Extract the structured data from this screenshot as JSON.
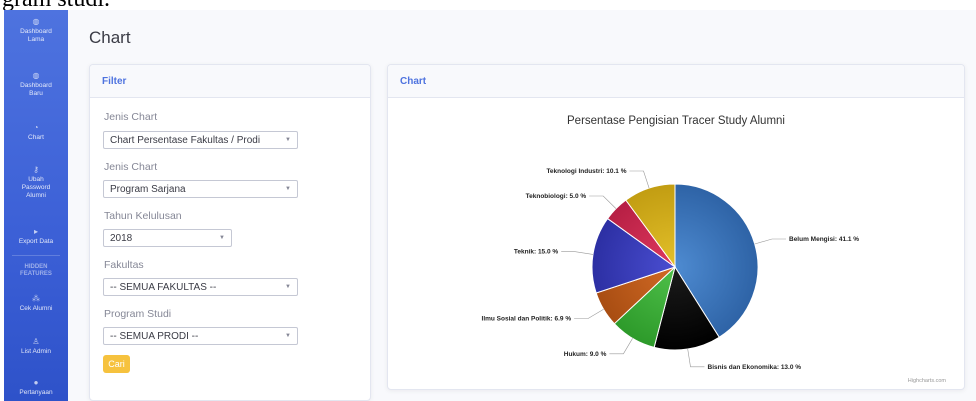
{
  "overflow_text": "gram studi.",
  "sidebar": {
    "items": [
      {
        "icon": "dashboard-icon",
        "label_lines": [
          "Dashboard",
          "Lama"
        ]
      },
      {
        "icon": "dashboard-icon",
        "label_lines": [
          "Dashboard",
          "Baru"
        ]
      },
      {
        "icon": "chart-icon",
        "label_lines": [
          "Chart"
        ]
      },
      {
        "icon": "key-icon",
        "label_lines": [
          "Ubah",
          "Password",
          "Alumni"
        ]
      },
      {
        "icon": "export-icon",
        "label_lines": [
          "Export Data"
        ]
      }
    ],
    "hidden_heading_lines": [
      "HIDDEN",
      "FEATURES"
    ],
    "hidden_items": [
      {
        "icon": "users-icon",
        "label_lines": [
          "Cek Alumni"
        ]
      },
      {
        "icon": "user-icon",
        "label_lines": [
          "List Admin"
        ]
      },
      {
        "icon": "question-icon",
        "label_lines": [
          "Pertanyaan"
        ]
      }
    ]
  },
  "page_title": "Chart",
  "filter": {
    "header": "Filter",
    "fields": [
      {
        "label": "Jenis Chart",
        "value": "Chart Persentase Fakultas / Prodi"
      },
      {
        "label": "Jenis Chart",
        "value": "Program Sarjana"
      },
      {
        "label": "Tahun Kelulusan",
        "value": "2018"
      },
      {
        "label": "Fakultas",
        "value": "-- SEMUA FAKULTAS --"
      },
      {
        "label": "Program Studi",
        "value": "-- SEMUA PRODI --"
      }
    ],
    "button": "Cari"
  },
  "chart_card": {
    "header": "Chart",
    "credit": "Highcharts.com"
  },
  "chart_data": {
    "type": "pie",
    "title": "Persentase Pengisian Tracer Study Alumni",
    "start_angle": 0,
    "slices": [
      {
        "name": "Belum Mengisi",
        "value": 41.1,
        "label": "Belum Mengisi: 41.1 %",
        "color": "#4e8bd1",
        "color2": "#2e63a6",
        "side": "right"
      },
      {
        "name": "Bisnis dan Ekonomika",
        "value": 13.0,
        "label": "Bisnis dan Ekonomika: 13.0 %",
        "color": "#1c1c1c",
        "color2": "#000000",
        "side": "right"
      },
      {
        "name": "Hukum",
        "value": 9.0,
        "label": "Hukum: 9.0 %",
        "color": "#4fc04a",
        "color2": "#2d9a2a",
        "side": "left"
      },
      {
        "name": "Ilmu Sosial dan Politik",
        "value": 6.9,
        "label": "Ilmu Sosial dan Politik: 6.9 %",
        "color": "#d26a25",
        "color2": "#a84d12",
        "side": "left"
      },
      {
        "name": "Teknik",
        "value": 15.0,
        "label": "Teknik: 15.0 %",
        "color": "#4a4ed1",
        "color2": "#2c2fa3",
        "side": "left"
      },
      {
        "name": "Teknobiologi",
        "value": 5.0,
        "label": "Teknobiologi: 5.0 %",
        "color": "#e0385e",
        "color2": "#b61f44",
        "side": "left"
      },
      {
        "name": "Teknologi Industri",
        "value": 10.1,
        "label": "Teknologi Industri: 10.1 %",
        "color": "#e3c02a",
        "color2": "#c29d12",
        "side": "left"
      }
    ]
  }
}
